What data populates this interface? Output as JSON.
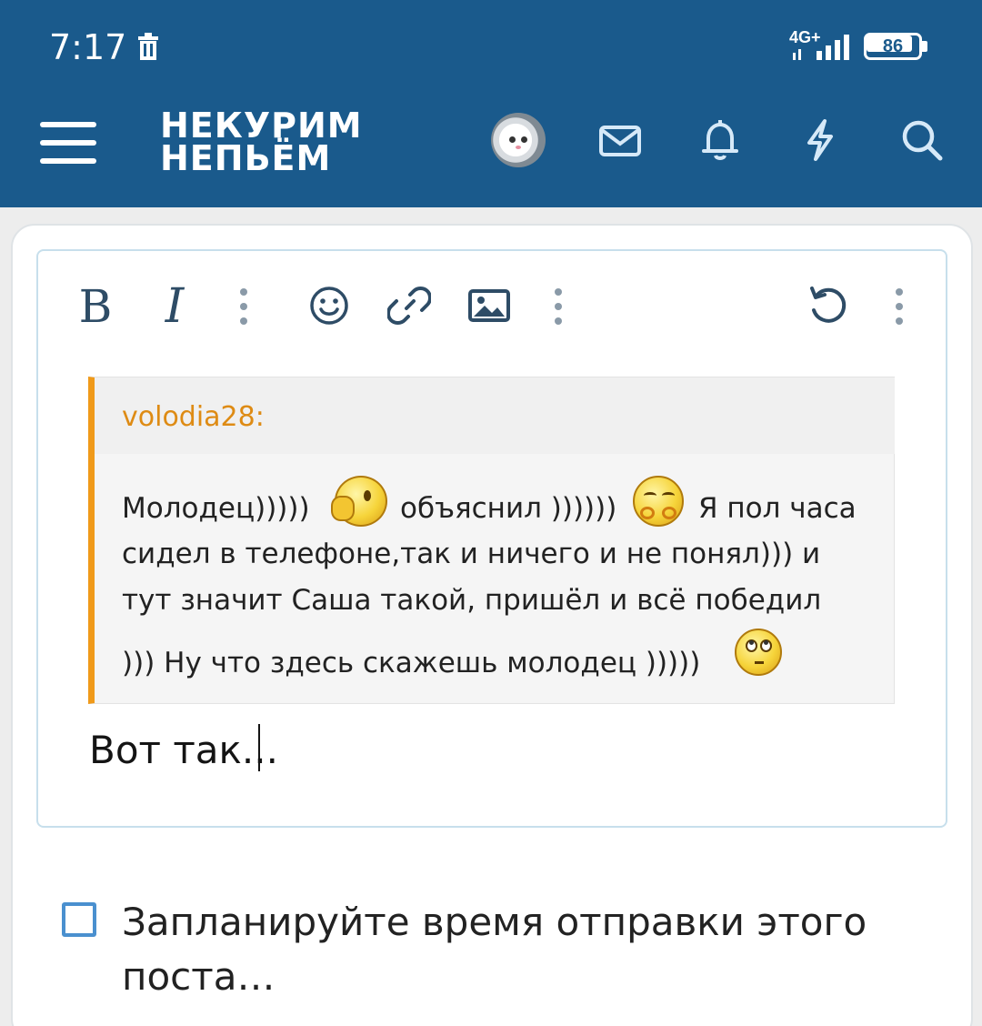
{
  "status_bar": {
    "time": "7:17",
    "network": "4G+",
    "battery": "86",
    "battery_level": 0.86
  },
  "header": {
    "menu_icon": "hamburger-menu-icon",
    "logo_line1": "НЕКУРИМ",
    "logo_line2": "НЕПЬЁМ",
    "icons": [
      "avatar",
      "mail-icon",
      "bell-icon",
      "bolt-icon",
      "search-icon"
    ]
  },
  "toolbar": {
    "bold_label": "B",
    "italic_label": "I",
    "icons": [
      "bold-icon",
      "italic-icon",
      "more-icon",
      "smiley-icon",
      "link-icon",
      "image-icon",
      "more-icon",
      "undo-icon",
      "more-icon"
    ]
  },
  "quote": {
    "author": "volodia28:",
    "line1_a": "Молодец)))))",
    "line1_b": "объяснил ))))))",
    "line1_c": "Я пол часа",
    "line2": "сидел в телефоне,так и ничего и не понял))) и",
    "line3": "тут значит Саша такой, пришёл и всё победил",
    "line4": "))) Ну что здесь скажешь молодец )))))"
  },
  "editor": {
    "text": "Вот так..."
  },
  "schedule": {
    "label": "Запланируйте время отправки этого поста…",
    "checked": false
  },
  "colors": {
    "header_bg": "#1a5a8c",
    "quote_accent": "#f09a1a",
    "author_color": "#de8b14",
    "checkbox_border": "#4a90cf"
  }
}
